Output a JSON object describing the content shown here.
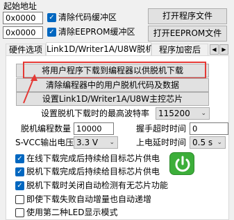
{
  "header": {
    "start_address_label": "起始地址",
    "address1": "0x0000",
    "address2": "0x0000",
    "clear_code_label": "清除代码缓冲区",
    "clear_eeprom_label": "清除EEPROM缓冲区",
    "open_program_label": "打开程序文件",
    "open_eeprom_label": "打开EEPROM文件"
  },
  "tabs": [
    {
      "label": "硬件选项"
    },
    {
      "label": "Link1D/Writer1A/U8W脱机"
    },
    {
      "label": "程序加密后"
    }
  ],
  "tab_scroll": {
    "left": "◀",
    "right": "▶"
  },
  "offline": {
    "btn_download": "将用户程序下载到编程器以供脱机下载",
    "btn_clear": "清除编程器中的用户脱机代码及数据",
    "btn_set_chip": "设置Link1D/Writer1A/U8W主控芯片",
    "baud_label": "设置脱机下载时的最高波特率",
    "baud_value": "115200",
    "count_label": "脱机编程数量",
    "count_value": "10000",
    "handshake_label": "握手超时时间",
    "handshake_value": "0",
    "svcc_label": "S-VCC输出电压",
    "svcc_value": "3.3 V",
    "delay_label": "上电延时时间",
    "delay_value": "0.5 s",
    "options": [
      {
        "label": "在线下载完成后持续给目标芯片供电",
        "checked": true
      },
      {
        "label": "脱机下载完成后持续给目标芯片供电",
        "checked": true
      },
      {
        "label": "脱机下载时关闭自动检测有无芯片功能",
        "checked": true
      },
      {
        "label": "即使下载失败自动增量也自动递增",
        "checked": false
      },
      {
        "label": "使用第二种LED显示模式",
        "checked": false
      }
    ]
  },
  "colors": {
    "highlight": "#e53935",
    "checkbox": "#0067c0",
    "power_button": "#3cae3a"
  },
  "icons": {
    "checkmark": "✓",
    "dropdown": "⌄",
    "power": "⏻"
  }
}
